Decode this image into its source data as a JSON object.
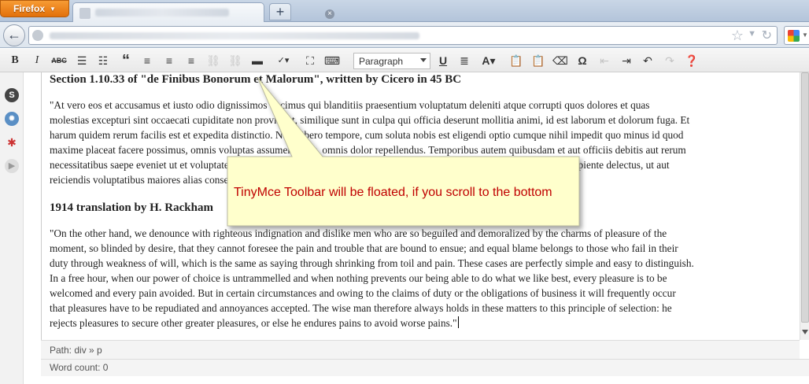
{
  "browser": {
    "menu_label": "Firefox"
  },
  "toolbar": {
    "buttons": {
      "bold": "B",
      "italic": "I",
      "strike": "ABC",
      "quote": "“",
      "omega": "Ω"
    },
    "format_value": "Paragraph"
  },
  "content": {
    "heading1": "Section 1.10.33 of \"de Finibus Bonorum et Malorum\", written by Cicero in 45 BC",
    "para1_lines": [
      "\"At vero eos et accusamus et iusto odio dignissimos ducimus qui blanditiis praesentium voluptatum deleniti atque corrupti quos dolores et quas",
      "molestias excepturi sint occaecati cupiditate non provident, similique sunt in culpa qui officia deserunt mollitia animi, id est laborum et dolorum fuga. Et",
      "harum quidem rerum facilis est et expedita distinctio. Nam libero tempore, cum soluta nobis est eligendi optio cumque nihil impedit quo minus id quod",
      "maxime placeat facere possimus, omnis voluptas assumenda est, omnis dolor repellendus. Temporibus autem quibusdam et aut officiis debitis aut rerum",
      "necessitatibus saepe eveniet ut et voluptates repudiandae sint et molestiae non recusandae. Itaque earum rerum hic tenetur a sapiente delectus, ut aut",
      "reiciendis voluptatibus maiores alias consequatur aut perferendis doloribus asperiores repellat.\""
    ],
    "heading2": "1914 translation by H. Rackham",
    "para2_lines": [
      "\"On the other hand, we denounce with righteous indignation and dislike men who are so beguiled and demoralized by the charms of pleasure of the",
      "moment, so blinded by desire, that they cannot foresee the pain and trouble that are bound to ensue; and equal blame belongs to those who fail in their",
      "duty through weakness of will, which is the same as saying through shrinking from toil and pain. These cases are perfectly simple and easy to distinguish.",
      "In a free hour, when our power of choice is untrammelled and when nothing prevents our being able to do what we like best, every pleasure is to be",
      "welcomed and every pain avoided. But in certain circumstances and owing to the claims of duty or the obligations of business it will frequently occur",
      "that pleasures have to be repudiated and annoyances accepted. The wise man therefore always holds in these matters to this principle of selection: he",
      "rejects pleasures to secure other greater pleasures, or else he endures pains to avoid worse pains.\""
    ]
  },
  "status": {
    "path": "Path: div » p",
    "word_count": "Word count: 0"
  },
  "callout": {
    "text": "TinyMce Toolbar will be floated, if you scroll to the bottom",
    "text_color": "#c00000",
    "fill_color": "#ffffcc"
  },
  "icons": {
    "sidebar": [
      "s-icon",
      "gear-icon",
      "bug-icon",
      "play-icon"
    ]
  }
}
